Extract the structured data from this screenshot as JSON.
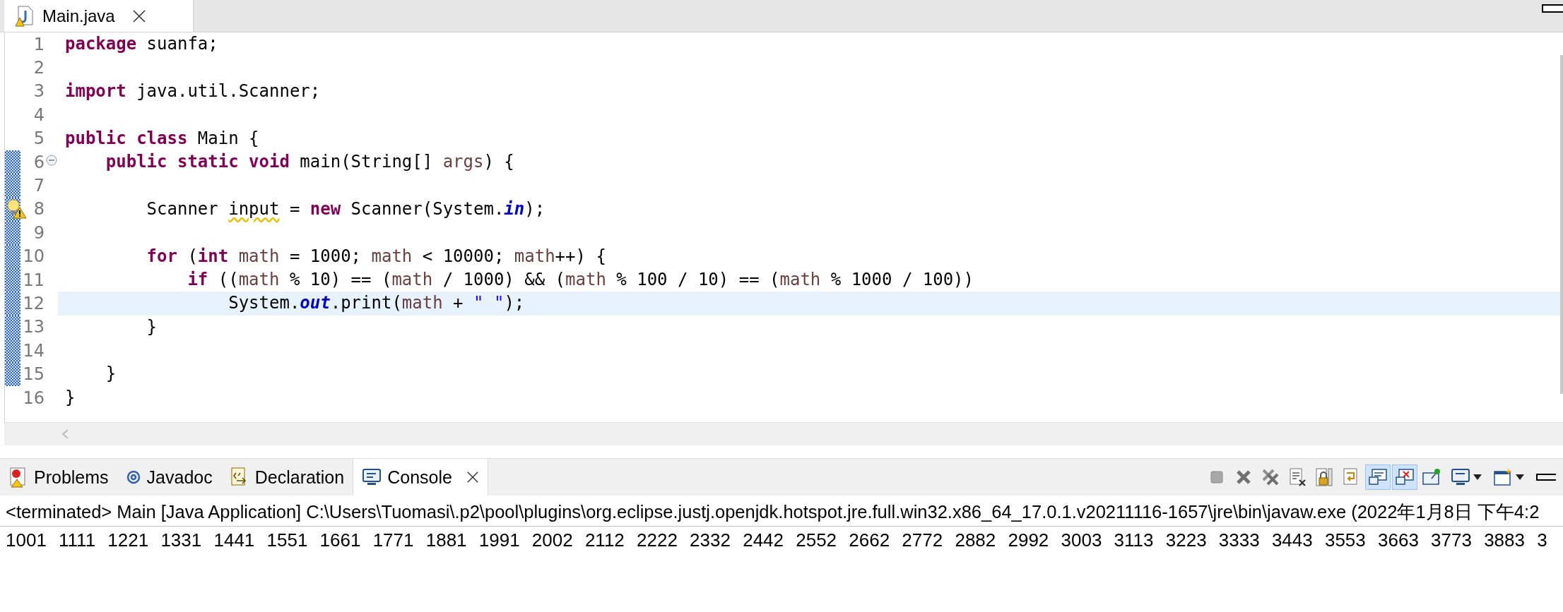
{
  "editor": {
    "tab": {
      "title": "Main.java",
      "selected": true
    },
    "lines": [
      {
        "number": "1",
        "changed": false,
        "fold": false,
        "warning": false,
        "current": false,
        "tokens": [
          {
            "t": "package",
            "kind": "keyword"
          },
          {
            "t": " suanfa;",
            "kind": "plain"
          }
        ]
      },
      {
        "number": "2",
        "changed": false,
        "fold": false,
        "warning": false,
        "current": false
      },
      {
        "number": "3",
        "changed": false,
        "fold": false,
        "warning": false,
        "current": false,
        "tokens": [
          {
            "t": "import",
            "kind": "keyword"
          },
          {
            "t": " java.util.Scanner;",
            "kind": "plain"
          }
        ]
      },
      {
        "number": "4",
        "changed": false,
        "fold": false,
        "warning": false,
        "current": false
      },
      {
        "number": "5",
        "changed": false,
        "fold": false,
        "warning": false,
        "current": false,
        "tokens": [
          {
            "t": "public class",
            "kind": "keyword"
          },
          {
            "t": " Main {",
            "kind": "plain"
          }
        ]
      },
      {
        "number": "6",
        "changed": true,
        "fold": true,
        "warning": false,
        "current": false,
        "tokens": [
          {
            "t": "    public static void",
            "kind": "keyword"
          },
          {
            "t": " main(String[] ",
            "kind": "plain"
          },
          {
            "t": "args",
            "kind": "variable"
          },
          {
            "t": ") {",
            "kind": "plain"
          }
        ]
      },
      {
        "number": "7",
        "changed": true,
        "fold": false,
        "warning": false,
        "current": false
      },
      {
        "number": "8",
        "changed": true,
        "fold": false,
        "warning": true,
        "current": false,
        "tokens": [
          {
            "t": "        Scanner ",
            "kind": "plain"
          },
          {
            "t": "input",
            "kind": "unused"
          },
          {
            "t": " = ",
            "kind": "plain"
          },
          {
            "t": "new",
            "kind": "keyword"
          },
          {
            "t": " Scanner(System.",
            "kind": "plain"
          },
          {
            "t": "in",
            "kind": "field"
          },
          {
            "t": ");",
            "kind": "plain"
          }
        ]
      },
      {
        "number": "9",
        "changed": true,
        "fold": false,
        "warning": false,
        "current": false
      },
      {
        "number": "10",
        "changed": true,
        "fold": false,
        "warning": false,
        "current": false,
        "tokens": [
          {
            "t": "        for",
            "kind": "keyword"
          },
          {
            "t": " (",
            "kind": "plain"
          },
          {
            "t": "int",
            "kind": "keyword"
          },
          {
            "t": " math",
            "kind": "variable"
          },
          {
            "t": " = 1000; ",
            "kind": "plain"
          },
          {
            "t": "math",
            "kind": "variable"
          },
          {
            "t": " < 10000; ",
            "kind": "plain"
          },
          {
            "t": "math",
            "kind": "variable"
          },
          {
            "t": "++) {",
            "kind": "plain"
          }
        ]
      },
      {
        "number": "11",
        "changed": true,
        "fold": false,
        "warning": false,
        "current": false,
        "tokens": [
          {
            "t": "            if",
            "kind": "keyword"
          },
          {
            "t": " ((",
            "kind": "plain"
          },
          {
            "t": "math",
            "kind": "variable"
          },
          {
            "t": " % 10) == (",
            "kind": "plain"
          },
          {
            "t": "math",
            "kind": "variable"
          },
          {
            "t": " / 1000) && (",
            "kind": "plain"
          },
          {
            "t": "math",
            "kind": "variable"
          },
          {
            "t": " % 100 / 10) == (",
            "kind": "plain"
          },
          {
            "t": "math",
            "kind": "variable"
          },
          {
            "t": " % 1000 / 100))",
            "kind": "plain"
          }
        ]
      },
      {
        "number": "12",
        "changed": true,
        "fold": false,
        "warning": false,
        "current": true,
        "tokens": [
          {
            "t": "                System.",
            "kind": "plain"
          },
          {
            "t": "out",
            "kind": "field"
          },
          {
            "t": ".print(",
            "kind": "plain"
          },
          {
            "t": "math",
            "kind": "variable"
          },
          {
            "t": " + ",
            "kind": "plain"
          },
          {
            "t": "\" \"",
            "kind": "string"
          },
          {
            "t": ");",
            "kind": "plain"
          }
        ]
      },
      {
        "number": "13",
        "changed": true,
        "fold": false,
        "warning": false,
        "current": false,
        "tokens": [
          {
            "t": "        }",
            "kind": "plain"
          }
        ]
      },
      {
        "number": "14",
        "changed": true,
        "fold": false,
        "warning": false,
        "current": false
      },
      {
        "number": "15",
        "changed": true,
        "fold": false,
        "warning": false,
        "current": false,
        "tokens": [
          {
            "t": "    }",
            "kind": "plain"
          }
        ]
      },
      {
        "number": "16",
        "changed": false,
        "fold": false,
        "warning": false,
        "current": false,
        "tokens": [
          {
            "t": "}",
            "kind": "plain"
          }
        ]
      }
    ]
  },
  "console": {
    "tabs": [
      {
        "kind": "problems",
        "label": "Problems",
        "selected": false
      },
      {
        "kind": "javadoc",
        "label": "Javadoc",
        "selected": false
      },
      {
        "kind": "declaration",
        "label": "Declaration",
        "selected": false
      },
      {
        "kind": "console",
        "label": "Console",
        "selected": true
      }
    ],
    "toolbar": [
      {
        "kind": "stop",
        "pressed": false
      },
      {
        "kind": "remove",
        "pressed": false
      },
      {
        "kind": "remove-all",
        "pressed": false
      },
      {
        "kind": "clear",
        "pressed": false
      },
      {
        "kind": "scroll-lock",
        "pressed": false
      },
      {
        "kind": "word-wrap",
        "pressed": false
      },
      {
        "kind": "stdout",
        "pressed": true
      },
      {
        "kind": "stderr",
        "pressed": true
      },
      {
        "kind": "pin",
        "pressed": false
      },
      {
        "kind": "display",
        "pressed": false
      },
      {
        "kind": "open",
        "pressed": false
      }
    ],
    "header": "<terminated> Main [Java Application] C:\\Users\\Tuomasi\\.p2\\pool\\plugins\\org.eclipse.justj.openjdk.hotspot.jre.full.win32.x86_64_17.0.1.v20211116-1657\\jre\\bin\\javaw.exe  (2022年1月8日 下午4:2",
    "output": "1001 1111 1221 1331 1441 1551 1661 1771 1881 1991 2002 2112 2222 2332 2442 2552 2662 2772 2882 2992 3003 3113 3223 3333 3443 3553 3663 3773 3883 3"
  }
}
